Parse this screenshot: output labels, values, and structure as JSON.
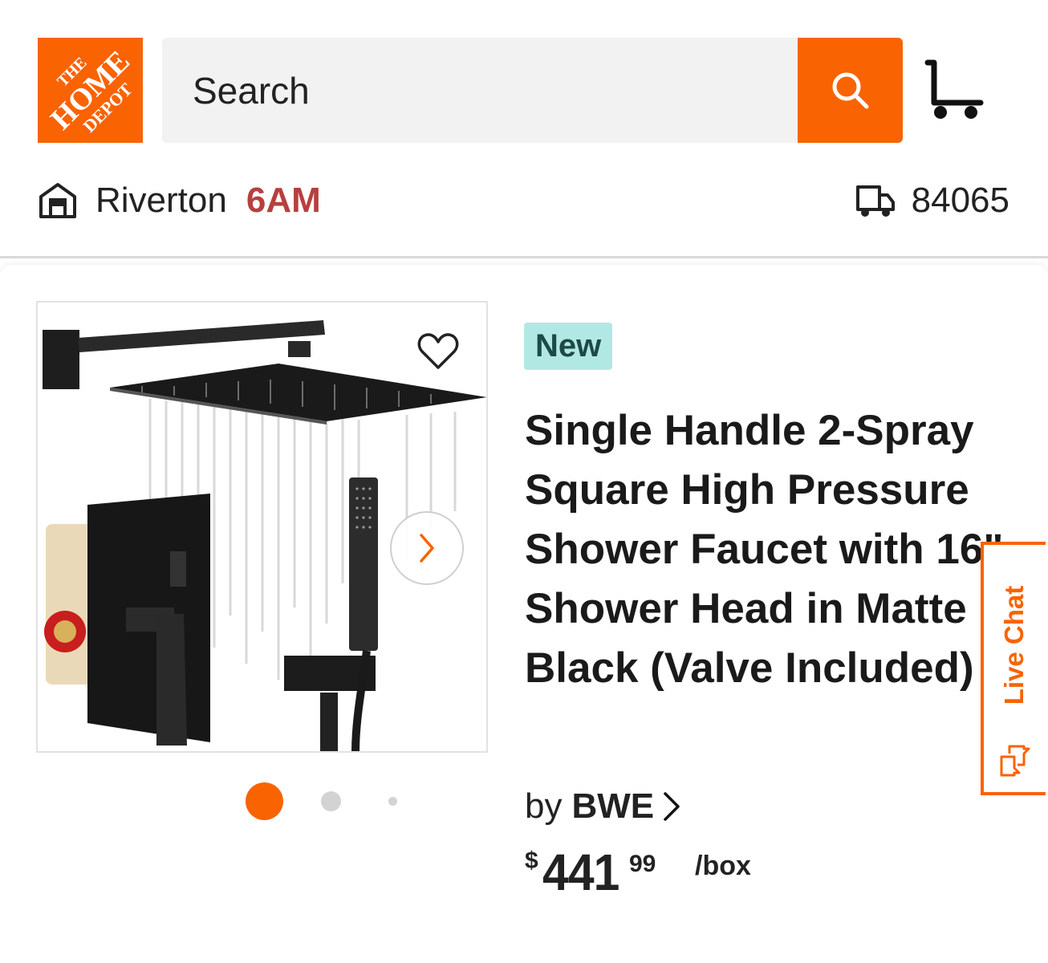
{
  "header": {
    "logo_text": [
      "THE",
      "HOME",
      "DEPOT"
    ],
    "search": {
      "placeholder": "Search"
    },
    "cart_icon": "cart-icon",
    "search_icon": "search-icon"
  },
  "location": {
    "store_name": "Riverton",
    "store_hours": "6AM",
    "zip": "84065"
  },
  "product": {
    "badge": "New",
    "title": "Single Handle 2-Spray Square High Pressure Shower Faucet with 16\" Shower Head in Matte Black (Valve Included)",
    "brand_prefix": "by",
    "brand": "BWE",
    "price": {
      "currency": "$",
      "dollars": "441",
      "cents": "99",
      "unit": "/box"
    },
    "image_carousel": {
      "count": 3,
      "active_index": 0
    }
  },
  "live_chat": {
    "label": "Live Chat"
  },
  "colors": {
    "brand_orange": "#f96302",
    "hours_red": "#b6403e",
    "badge_bg": "#b2e8e3",
    "badge_text": "#1d4a47"
  }
}
